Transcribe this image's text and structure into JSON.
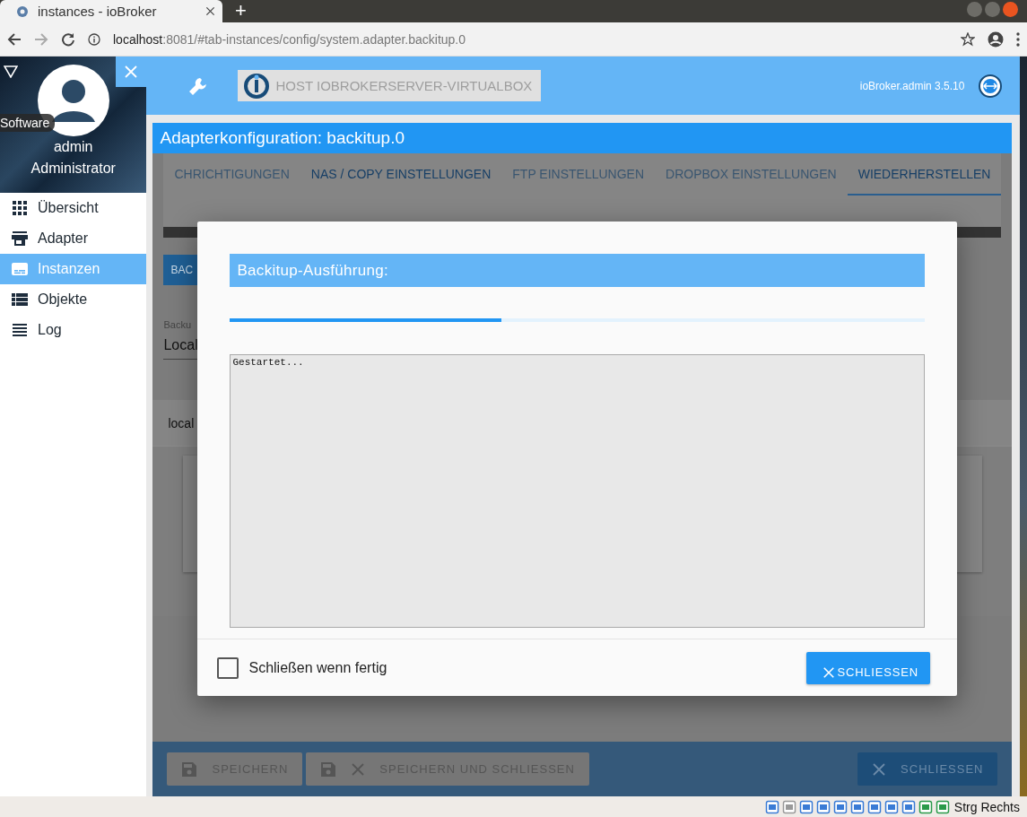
{
  "browser": {
    "tab_title": "instances - ioBroker",
    "new_tab": "+",
    "url_host": "localhost",
    "url_rest": ":8081/#tab-instances/config/system.adapter.backitup.0"
  },
  "sidebar": {
    "banner_tag": "Software",
    "user": "admin",
    "role": "Administrator",
    "items": [
      {
        "label": "Übersicht",
        "kind": "grid",
        "selected": false
      },
      {
        "label": "Adapter",
        "kind": "store",
        "selected": false
      },
      {
        "label": "Instanzen",
        "kind": "instances",
        "selected": true
      },
      {
        "label": "Objekte",
        "kind": "list",
        "selected": false
      },
      {
        "label": "Log",
        "kind": "lines",
        "selected": false
      }
    ]
  },
  "header": {
    "host": "HOST IOBROKERSERVER-VIRTUALBOX",
    "version": "ioBroker.admin 3.5.10"
  },
  "config": {
    "title": "Adapterkonfiguration: backitup.0",
    "tabs": [
      {
        "label": "CHRICHTIGUNGEN",
        "selected": false,
        "disabled": true
      },
      {
        "label": "NAS / COPY EINSTELLUNGEN",
        "selected": false,
        "disabled": false
      },
      {
        "label": "FTP EINSTELLUNGEN",
        "selected": false,
        "disabled": true
      },
      {
        "label": "DROPBOX EINSTELLUNGEN",
        "selected": false,
        "disabled": true
      },
      {
        "label": "WIEDERHERSTELLEN",
        "selected": true,
        "disabled": false
      }
    ],
    "button": "BAC",
    "field_label": "Backu",
    "field_value": "Local",
    "card_title": "local"
  },
  "dialog": {
    "title": "Backitup-Ausführung:",
    "progress": {
      "level": 0.39
    },
    "log": "Gestartet...",
    "close_when_done": {
      "label": "Schließen wenn fertig",
      "checked": false
    },
    "close_button": "SCHLIESSEN"
  },
  "footer": {
    "buttons": [
      {
        "label": "SPEICHERN",
        "kind": "save"
      },
      {
        "label": "SPEICHERN UND SCHLIESSEN",
        "kind": "save_close"
      },
      {
        "label": "SCHLIESSEN",
        "kind": "close"
      }
    ]
  },
  "vm_status": {
    "keyboard": "Strg Rechts"
  }
}
